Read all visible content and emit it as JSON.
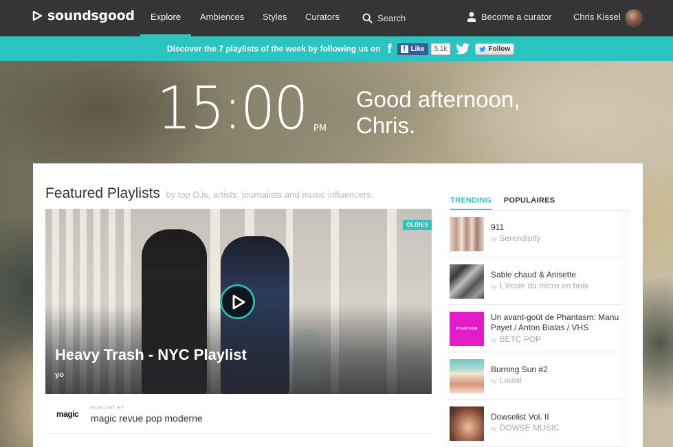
{
  "app": {
    "logo_text": "soundsgood"
  },
  "nav": {
    "items": [
      {
        "label": "Explore",
        "active": true
      },
      {
        "label": "Ambiences"
      },
      {
        "label": "Styles"
      },
      {
        "label": "Curators"
      }
    ],
    "search_label": "Search",
    "become_curator_label": "Become a curator",
    "user_name": "Chris Kissel"
  },
  "banner": {
    "text": "Discover the 7 playlists of the week by following us on",
    "fb_like_label": "Like",
    "fb_like_count": "5.1k",
    "tw_follow_label": "Follow"
  },
  "clock": {
    "time": "15:00",
    "ampm": "PM",
    "greeting_line1": "Good afternoon,",
    "greeting_line2": "Chris."
  },
  "featured": {
    "title": "Featured Playlists",
    "subtitle": "by top DJs, artists, journalists and music influencers.",
    "hero": {
      "badge": "OLDIES",
      "title": "Heavy Trash - NYC Playlist",
      "subtitle": "yo",
      "by_label": "PLAYLIST BY",
      "curator_logo": "magic",
      "curator_name": "magic revue pop moderne"
    }
  },
  "side_panel": {
    "tabs": [
      {
        "label": "TRENDING",
        "active": true
      },
      {
        "label": "POPULAIRES"
      }
    ],
    "by_prefix": "by",
    "items": [
      {
        "title": "911",
        "curator": "Serendipity"
      },
      {
        "title": "Sable chaud & Anisette",
        "curator": "L'école du micro en bois"
      },
      {
        "title": "Un avant-goût de Phantasm: Manu Payet / Anton Bialas / VHS",
        "curator": "BETC POP",
        "thumb_text": "PHANTASM"
      },
      {
        "title": "Burning Sun #2",
        "curator": "Loulal"
      },
      {
        "title": "Dowselist Vol. II",
        "curator": "DOWSE MUSIC"
      }
    ]
  },
  "colors": {
    "accent": "#2cc4c0",
    "nav_bg": "#353538",
    "facebook": "#3b5a9b",
    "phantasm_pink": "#e21cc8"
  }
}
